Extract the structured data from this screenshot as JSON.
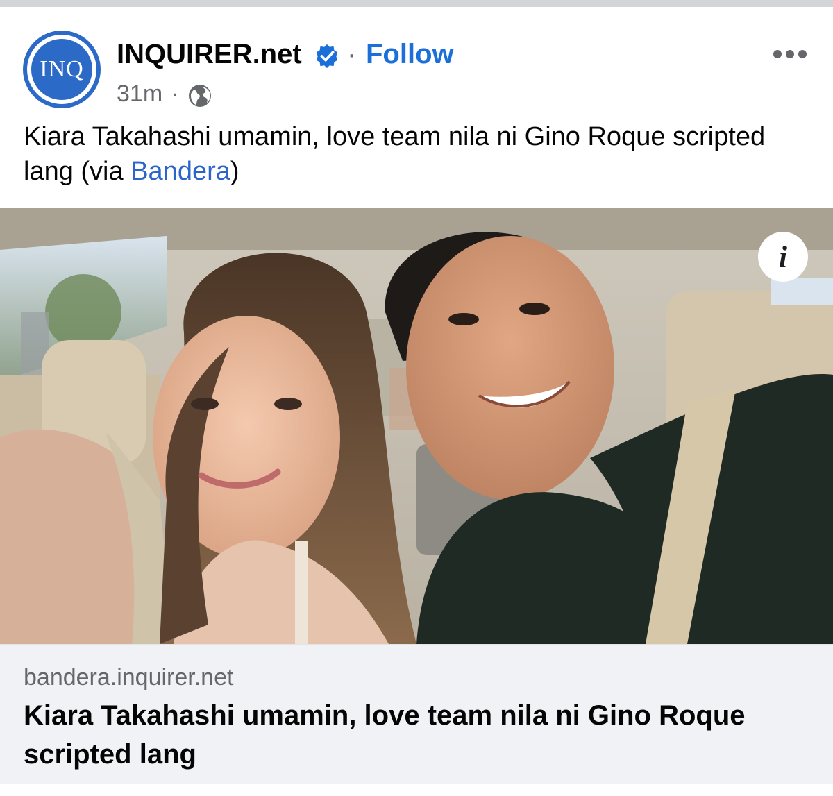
{
  "post": {
    "page_name": "INQUIRER.net",
    "avatar_text": "INQ",
    "separator": "·",
    "follow_label": "Follow",
    "time": "31m",
    "time_separator": "·",
    "caption_main": "Kiara Takahashi umamin, love team nila ni Gino Roque scripted lang (via ",
    "caption_link": "Bandera",
    "caption_end": ")",
    "info_label": "i"
  },
  "link_preview": {
    "domain": "bandera.inquirer.net",
    "title": "Kiara Takahashi umamin, love team nila ni Gino Roque scripted lang"
  },
  "colors": {
    "brand_blue": "#2c6ac7",
    "follow_blue": "#1b6fd8",
    "link_blue": "#2b65c9",
    "muted_text": "#65676b",
    "card_bg": "#f0f2f5"
  },
  "icons": {
    "verified": "verified-badge-icon",
    "audience": "globe-icon",
    "more": "more-options-icon",
    "info": "info-icon"
  }
}
